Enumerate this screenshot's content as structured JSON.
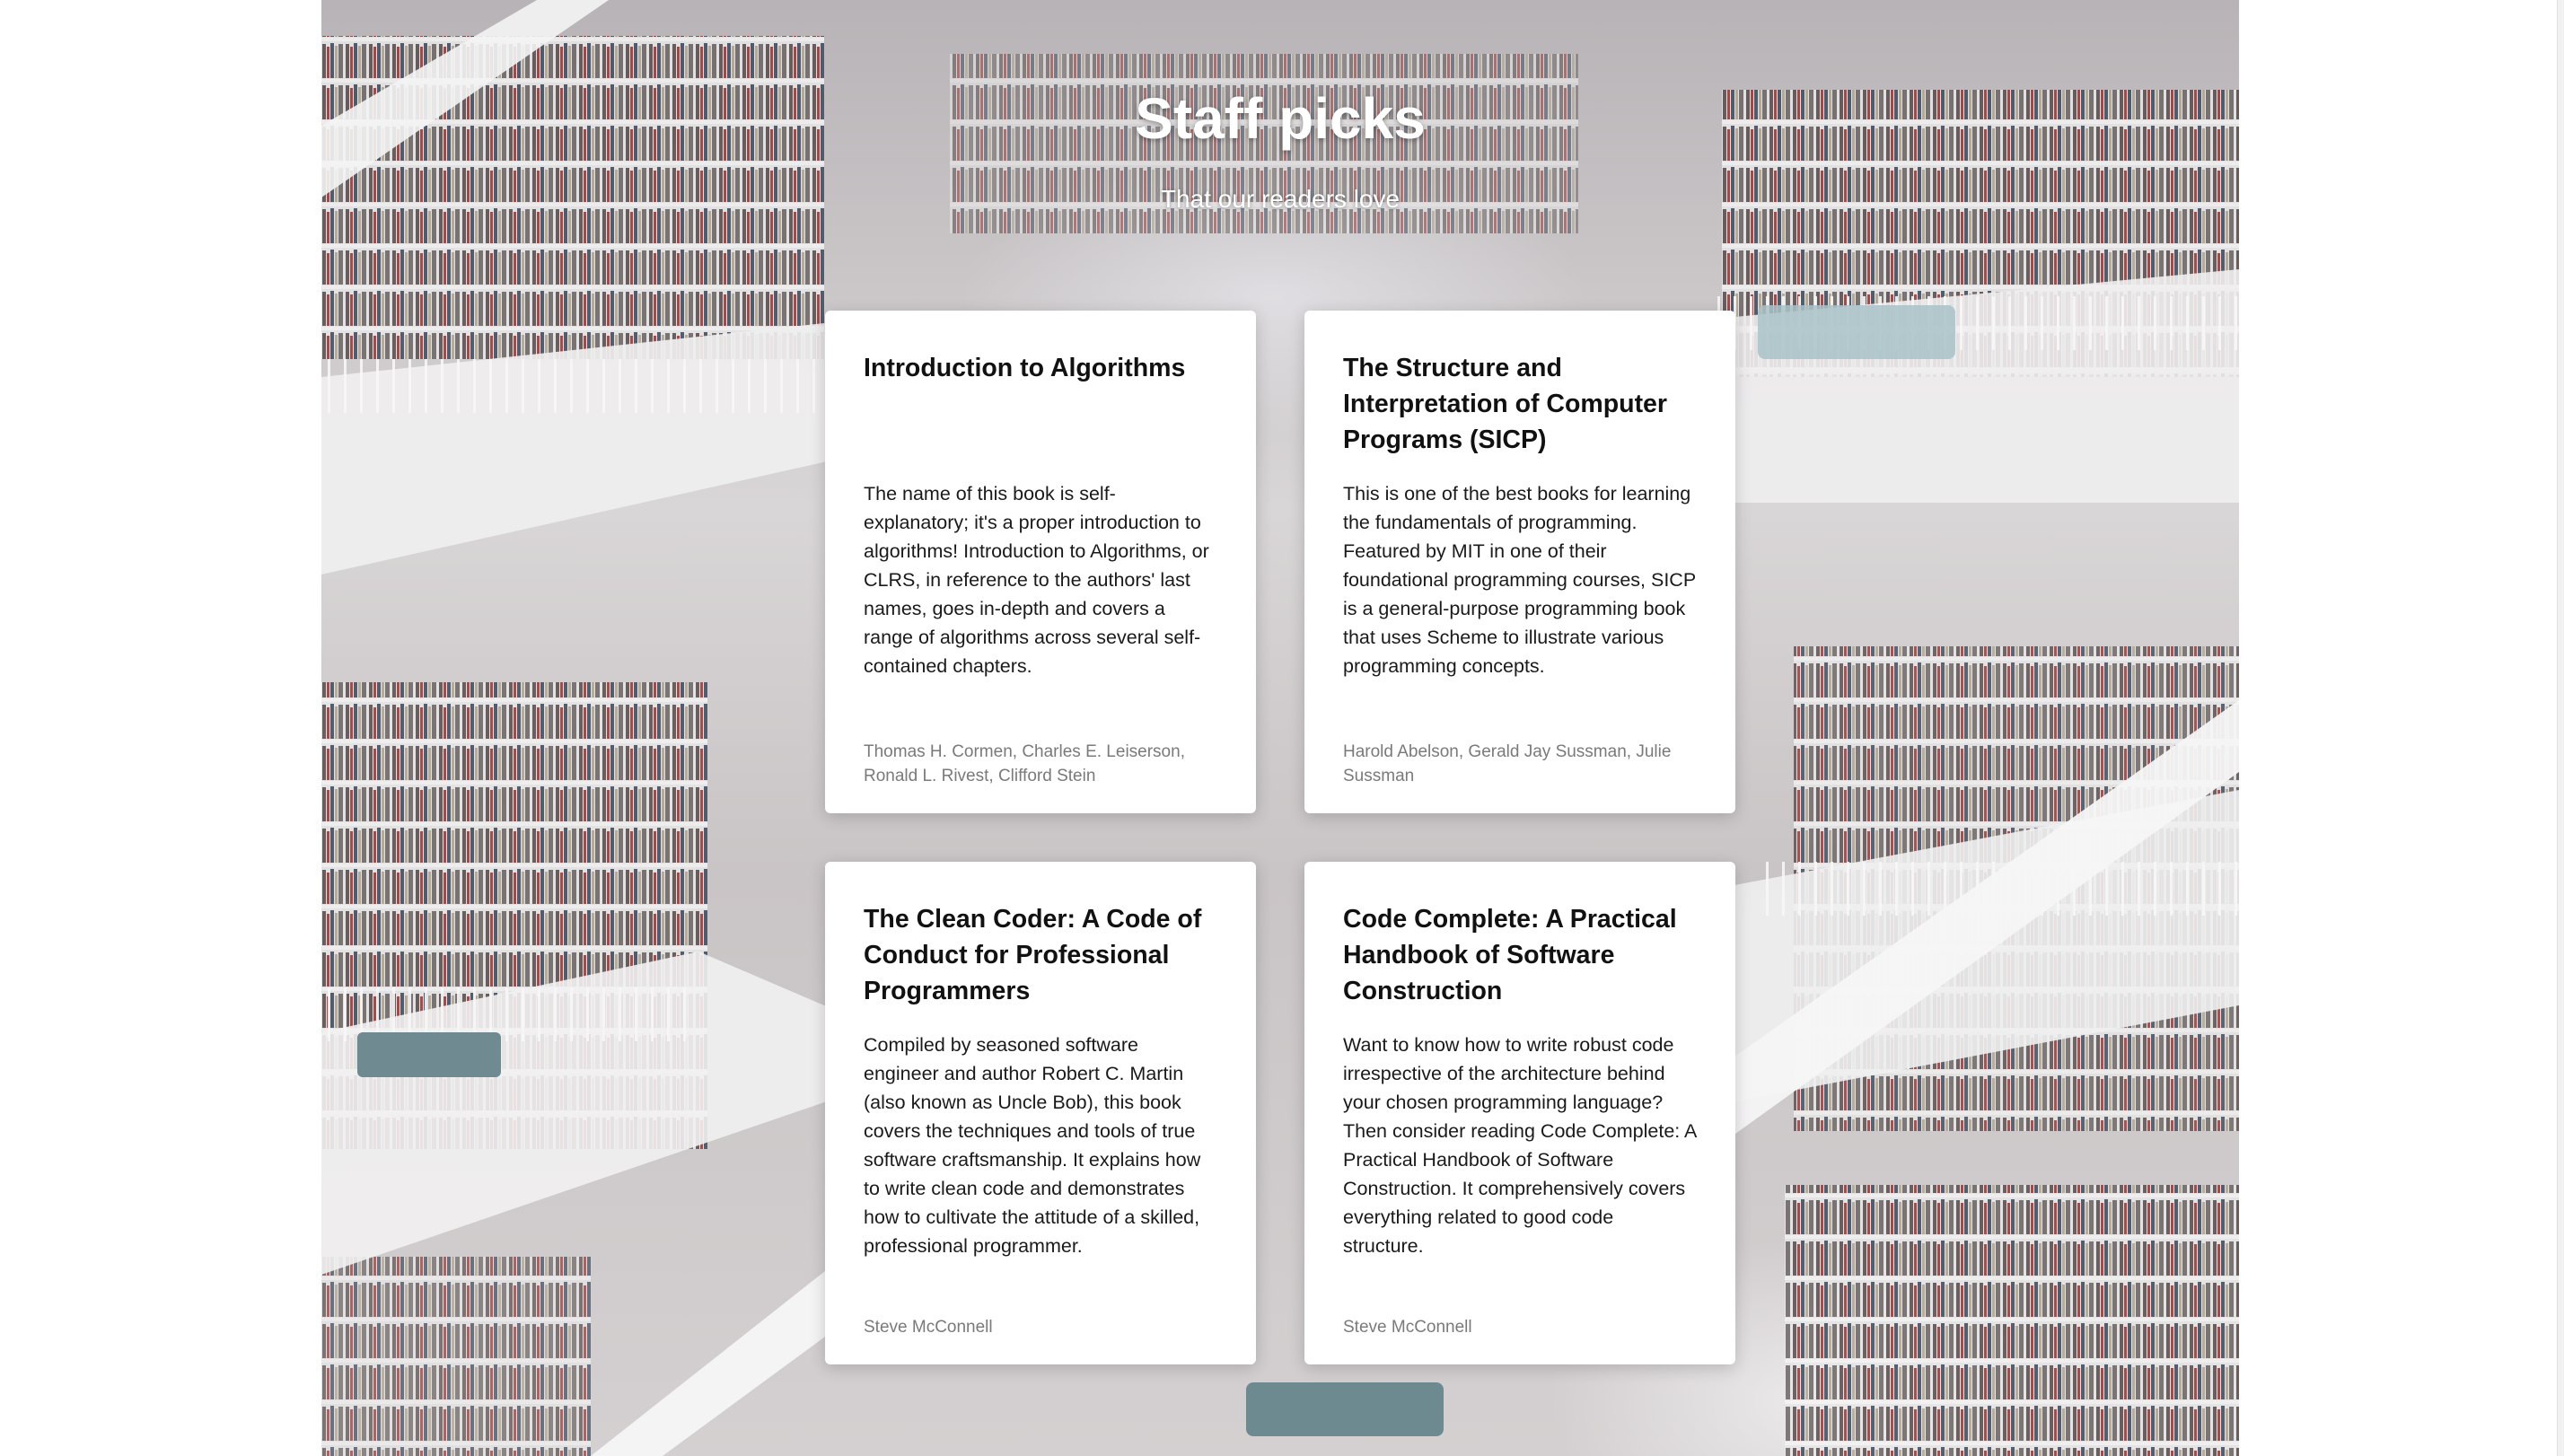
{
  "header": {
    "title": "Staff picks",
    "subtitle": "That our readers love"
  },
  "books": [
    {
      "title": "Introduction to Algorithms",
      "description": "The name of this book is self-explanatory; it's a proper introduction to algorithms! Introduction to Algorithms, or CLRS, in reference to the authors' last names, goes in-depth and covers a range of algorithms across several self-contained chapters.",
      "authors": "Thomas H. Cormen, Charles E. Leiserson, Ronald L. Rivest, Clifford Stein"
    },
    {
      "title": "The Structure and Interpretation of Computer Programs (SICP)",
      "description": "This is one of the best books for learning the fundamentals of programming. Featured by MIT in one of their foundational programming courses, SICP is a general-purpose programming book that uses Scheme to illustrate various programming concepts.",
      "authors": "Harold Abelson, Gerald Jay Sussman, Julie Sussman"
    },
    {
      "title": "The Clean Coder: A Code of Conduct for Professional Programmers",
      "description": "Compiled by seasoned software engineer and author Robert C. Martin (also known as Uncle Bob), this book covers the techniques and tools of true software craftsmanship. It explains how to write clean code and demonstrates how to cultivate the attitude of a skilled, professional programmer.",
      "authors": "Steve McConnell"
    },
    {
      "title": "Code Complete: A Practical Handbook of Software Construction",
      "description": "Want to know how to write robust code irrespective of the architecture behind your chosen programming language? Then consider reading Code Complete: A Practical Handbook of Software Construction. It comprehensively covers everything related to good code structure.",
      "authors": "Steve McConnell"
    }
  ]
}
